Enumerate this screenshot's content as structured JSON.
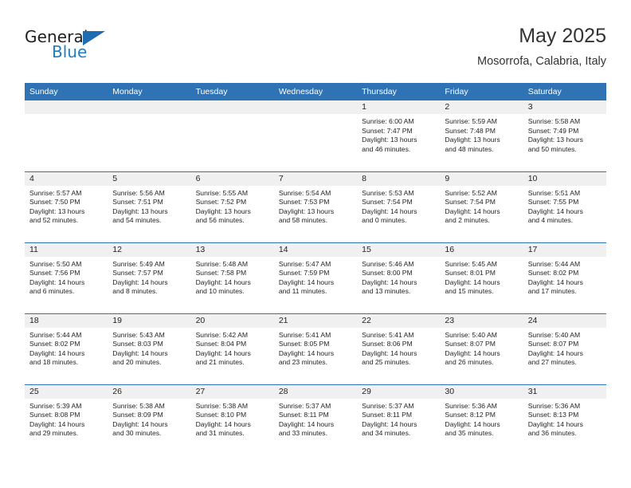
{
  "brand": {
    "name_part1": "General",
    "name_part2": "Blue",
    "logo_icon": "triangle-logo-icon",
    "colors": {
      "dark": "#231f20",
      "blue": "#1f7cc4",
      "triangle": "#1f6cb0"
    }
  },
  "header": {
    "title": "May 2025",
    "subtitle": "Mosorrofa, Calabria, Italy"
  },
  "theme": {
    "header_blue": "#3073b4",
    "date_band_gray": "#f0f0f0",
    "text": "#231f20"
  },
  "calendar": {
    "weekdays": [
      "Sunday",
      "Monday",
      "Tuesday",
      "Wednesday",
      "Thursday",
      "Friday",
      "Saturday"
    ],
    "weeks": [
      [
        {
          "day": "",
          "sunrise": "",
          "sunset": "",
          "daylight1": "",
          "daylight2": ""
        },
        {
          "day": "",
          "sunrise": "",
          "sunset": "",
          "daylight1": "",
          "daylight2": ""
        },
        {
          "day": "",
          "sunrise": "",
          "sunset": "",
          "daylight1": "",
          "daylight2": ""
        },
        {
          "day": "",
          "sunrise": "",
          "sunset": "",
          "daylight1": "",
          "daylight2": ""
        },
        {
          "day": "1",
          "sunrise": "Sunrise: 6:00 AM",
          "sunset": "Sunset: 7:47 PM",
          "daylight1": "Daylight: 13 hours",
          "daylight2": "and 46 minutes."
        },
        {
          "day": "2",
          "sunrise": "Sunrise: 5:59 AM",
          "sunset": "Sunset: 7:48 PM",
          "daylight1": "Daylight: 13 hours",
          "daylight2": "and 48 minutes."
        },
        {
          "day": "3",
          "sunrise": "Sunrise: 5:58 AM",
          "sunset": "Sunset: 7:49 PM",
          "daylight1": "Daylight: 13 hours",
          "daylight2": "and 50 minutes."
        }
      ],
      [
        {
          "day": "4",
          "sunrise": "Sunrise: 5:57 AM",
          "sunset": "Sunset: 7:50 PM",
          "daylight1": "Daylight: 13 hours",
          "daylight2": "and 52 minutes."
        },
        {
          "day": "5",
          "sunrise": "Sunrise: 5:56 AM",
          "sunset": "Sunset: 7:51 PM",
          "daylight1": "Daylight: 13 hours",
          "daylight2": "and 54 minutes."
        },
        {
          "day": "6",
          "sunrise": "Sunrise: 5:55 AM",
          "sunset": "Sunset: 7:52 PM",
          "daylight1": "Daylight: 13 hours",
          "daylight2": "and 56 minutes."
        },
        {
          "day": "7",
          "sunrise": "Sunrise: 5:54 AM",
          "sunset": "Sunset: 7:53 PM",
          "daylight1": "Daylight: 13 hours",
          "daylight2": "and 58 minutes."
        },
        {
          "day": "8",
          "sunrise": "Sunrise: 5:53 AM",
          "sunset": "Sunset: 7:54 PM",
          "daylight1": "Daylight: 14 hours",
          "daylight2": "and 0 minutes."
        },
        {
          "day": "9",
          "sunrise": "Sunrise: 5:52 AM",
          "sunset": "Sunset: 7:54 PM",
          "daylight1": "Daylight: 14 hours",
          "daylight2": "and 2 minutes."
        },
        {
          "day": "10",
          "sunrise": "Sunrise: 5:51 AM",
          "sunset": "Sunset: 7:55 PM",
          "daylight1": "Daylight: 14 hours",
          "daylight2": "and 4 minutes."
        }
      ],
      [
        {
          "day": "11",
          "sunrise": "Sunrise: 5:50 AM",
          "sunset": "Sunset: 7:56 PM",
          "daylight1": "Daylight: 14 hours",
          "daylight2": "and 6 minutes."
        },
        {
          "day": "12",
          "sunrise": "Sunrise: 5:49 AM",
          "sunset": "Sunset: 7:57 PM",
          "daylight1": "Daylight: 14 hours",
          "daylight2": "and 8 minutes."
        },
        {
          "day": "13",
          "sunrise": "Sunrise: 5:48 AM",
          "sunset": "Sunset: 7:58 PM",
          "daylight1": "Daylight: 14 hours",
          "daylight2": "and 10 minutes."
        },
        {
          "day": "14",
          "sunrise": "Sunrise: 5:47 AM",
          "sunset": "Sunset: 7:59 PM",
          "daylight1": "Daylight: 14 hours",
          "daylight2": "and 11 minutes."
        },
        {
          "day": "15",
          "sunrise": "Sunrise: 5:46 AM",
          "sunset": "Sunset: 8:00 PM",
          "daylight1": "Daylight: 14 hours",
          "daylight2": "and 13 minutes."
        },
        {
          "day": "16",
          "sunrise": "Sunrise: 5:45 AM",
          "sunset": "Sunset: 8:01 PM",
          "daylight1": "Daylight: 14 hours",
          "daylight2": "and 15 minutes."
        },
        {
          "day": "17",
          "sunrise": "Sunrise: 5:44 AM",
          "sunset": "Sunset: 8:02 PM",
          "daylight1": "Daylight: 14 hours",
          "daylight2": "and 17 minutes."
        }
      ],
      [
        {
          "day": "18",
          "sunrise": "Sunrise: 5:44 AM",
          "sunset": "Sunset: 8:02 PM",
          "daylight1": "Daylight: 14 hours",
          "daylight2": "and 18 minutes."
        },
        {
          "day": "19",
          "sunrise": "Sunrise: 5:43 AM",
          "sunset": "Sunset: 8:03 PM",
          "daylight1": "Daylight: 14 hours",
          "daylight2": "and 20 minutes."
        },
        {
          "day": "20",
          "sunrise": "Sunrise: 5:42 AM",
          "sunset": "Sunset: 8:04 PM",
          "daylight1": "Daylight: 14 hours",
          "daylight2": "and 21 minutes."
        },
        {
          "day": "21",
          "sunrise": "Sunrise: 5:41 AM",
          "sunset": "Sunset: 8:05 PM",
          "daylight1": "Daylight: 14 hours",
          "daylight2": "and 23 minutes."
        },
        {
          "day": "22",
          "sunrise": "Sunrise: 5:41 AM",
          "sunset": "Sunset: 8:06 PM",
          "daylight1": "Daylight: 14 hours",
          "daylight2": "and 25 minutes."
        },
        {
          "day": "23",
          "sunrise": "Sunrise: 5:40 AM",
          "sunset": "Sunset: 8:07 PM",
          "daylight1": "Daylight: 14 hours",
          "daylight2": "and 26 minutes."
        },
        {
          "day": "24",
          "sunrise": "Sunrise: 5:40 AM",
          "sunset": "Sunset: 8:07 PM",
          "daylight1": "Daylight: 14 hours",
          "daylight2": "and 27 minutes."
        }
      ],
      [
        {
          "day": "25",
          "sunrise": "Sunrise: 5:39 AM",
          "sunset": "Sunset: 8:08 PM",
          "daylight1": "Daylight: 14 hours",
          "daylight2": "and 29 minutes."
        },
        {
          "day": "26",
          "sunrise": "Sunrise: 5:38 AM",
          "sunset": "Sunset: 8:09 PM",
          "daylight1": "Daylight: 14 hours",
          "daylight2": "and 30 minutes."
        },
        {
          "day": "27",
          "sunrise": "Sunrise: 5:38 AM",
          "sunset": "Sunset: 8:10 PM",
          "daylight1": "Daylight: 14 hours",
          "daylight2": "and 31 minutes."
        },
        {
          "day": "28",
          "sunrise": "Sunrise: 5:37 AM",
          "sunset": "Sunset: 8:11 PM",
          "daylight1": "Daylight: 14 hours",
          "daylight2": "and 33 minutes."
        },
        {
          "day": "29",
          "sunrise": "Sunrise: 5:37 AM",
          "sunset": "Sunset: 8:11 PM",
          "daylight1": "Daylight: 14 hours",
          "daylight2": "and 34 minutes."
        },
        {
          "day": "30",
          "sunrise": "Sunrise: 5:36 AM",
          "sunset": "Sunset: 8:12 PM",
          "daylight1": "Daylight: 14 hours",
          "daylight2": "and 35 minutes."
        },
        {
          "day": "31",
          "sunrise": "Sunrise: 5:36 AM",
          "sunset": "Sunset: 8:13 PM",
          "daylight1": "Daylight: 14 hours",
          "daylight2": "and 36 minutes."
        }
      ]
    ]
  }
}
